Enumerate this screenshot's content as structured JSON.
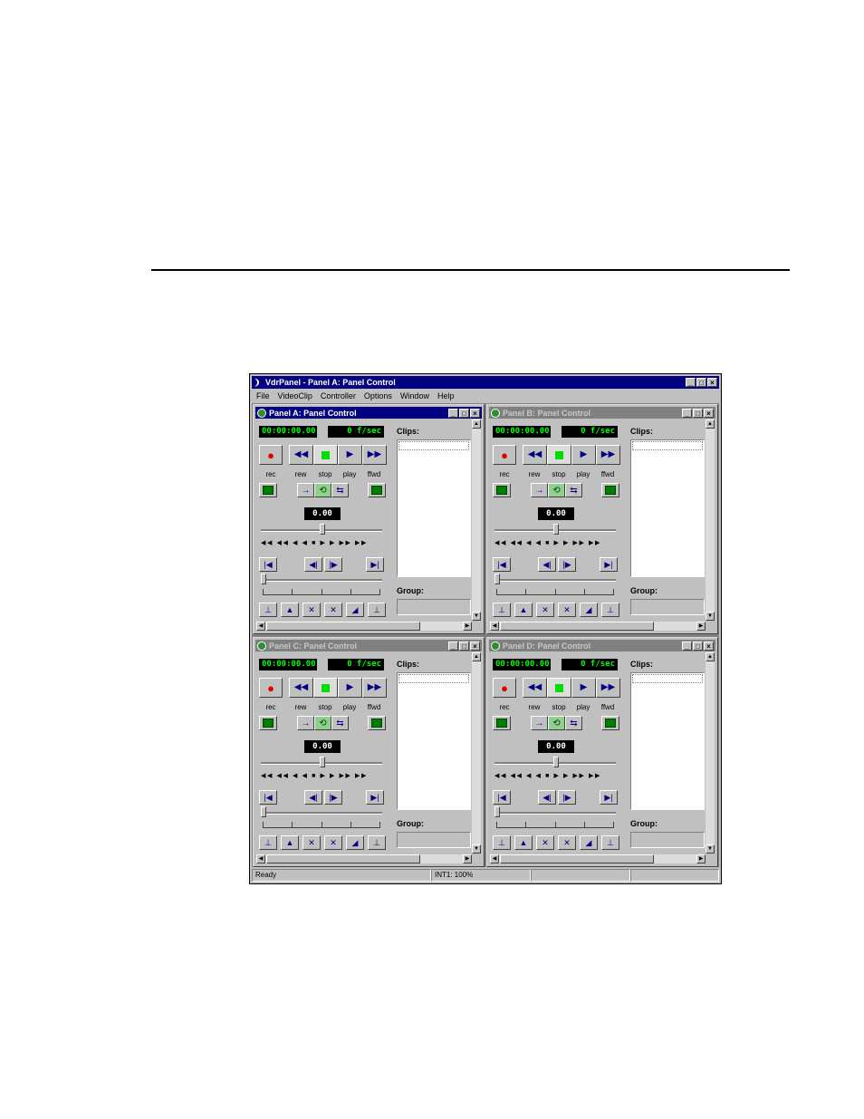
{
  "window": {
    "title": "VdrPanel - Panel A: Panel Control"
  },
  "menu": [
    "File",
    "VideoClip",
    "Controller",
    "Options",
    "Window",
    "Help"
  ],
  "window_buttons": {
    "minimize": "_",
    "maximize": "□",
    "close": "×"
  },
  "panels": [
    {
      "title": "Panel A: Panel Control",
      "timecode": "00:00:00.00",
      "framerate": "0 f/sec",
      "value": "0.00",
      "clips_label": "Clips:",
      "group_label": "Group:"
    },
    {
      "title": "Panel B: Panel Control",
      "timecode": "00:00:00.00",
      "framerate": "0 f/sec",
      "value": "0.00",
      "clips_label": "Clips:",
      "group_label": "Group:"
    },
    {
      "title": "Panel C: Panel Control",
      "timecode": "00:00:00.00",
      "framerate": "0 f/sec",
      "value": "0.00",
      "clips_label": "Clips:",
      "group_label": "Group:"
    },
    {
      "title": "Panel D: Panel Control",
      "timecode": "00:00:00.00",
      "framerate": "0 f/sec",
      "value": "0.00",
      "clips_label": "Clips:",
      "group_label": "Group:"
    }
  ],
  "transport_labels": {
    "rec": "rec",
    "rew": "rew",
    "stop": "stop",
    "play": "play",
    "ffwd": "ffwd"
  },
  "jog_glyphs": "◀◀ ◀◀ ◀ ◀ ■ ▶ ▶ ▶▶ ▶▶",
  "status": {
    "ready": "Ready",
    "int": "INT1: 100%"
  },
  "colors": {
    "titlebar_active": "#000080",
    "lcd_text": "#00ff00",
    "face": "#c0c0c0",
    "record": "#e00000"
  }
}
